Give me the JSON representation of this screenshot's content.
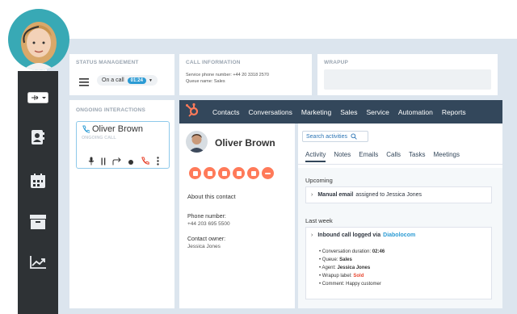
{
  "status_management": {
    "title": "STATUS MANAGEMENT",
    "status_label": "On a call",
    "timer": "01:24"
  },
  "call_information": {
    "title": "CALL INFORMATION",
    "service_phone": "Service phone number: +44 20 3318 2570",
    "queue_name": "Queue name: Sales"
  },
  "wrapup": {
    "title": "WRAPUP"
  },
  "ongoing": {
    "title": "ONGOING INTERACTIONS",
    "name": "Oliver Brown",
    "status": "ONGOING CALL"
  },
  "nav": {
    "items": [
      "Contacts",
      "Conversations",
      "Marketing",
      "Sales",
      "Service",
      "Automation",
      "Reports"
    ]
  },
  "contact": {
    "name": "Oliver Brown",
    "about": "About this contact",
    "phone_label": "Phone number:",
    "phone": "+44 203 695 5500",
    "owner_label": "Contact owner:",
    "owner": "Jessica Jones"
  },
  "activity": {
    "search": "Search activities",
    "tabs": [
      "Activity",
      "Notes",
      "Emails",
      "Calls",
      "Tasks",
      "Meetings"
    ],
    "upcoming_label": "Upcoming",
    "upcoming_bold": "Manual email",
    "upcoming_rest": "assigned to Jessica Jones",
    "lastweek_label": "Last week",
    "log_title": "Inbound call logged via",
    "log_link": "Diabolocom",
    "d1_label": "Conversation duration:",
    "d1_val": "02:46",
    "d2_label": "Queue:",
    "d2_val": "Sales",
    "d3_label": "Agent:",
    "d3_val": "Jessica Jones",
    "d4_label": "Wrapup label:",
    "d4_val": "Sold",
    "d5_label": "Comment:",
    "d5_val": "Happy customer"
  },
  "colors": {
    "accent": "#ff7a59",
    "nav": "#33475b",
    "sidebar": "#2e3235",
    "link": "#2b9bd4",
    "sold": "#e8452f"
  }
}
